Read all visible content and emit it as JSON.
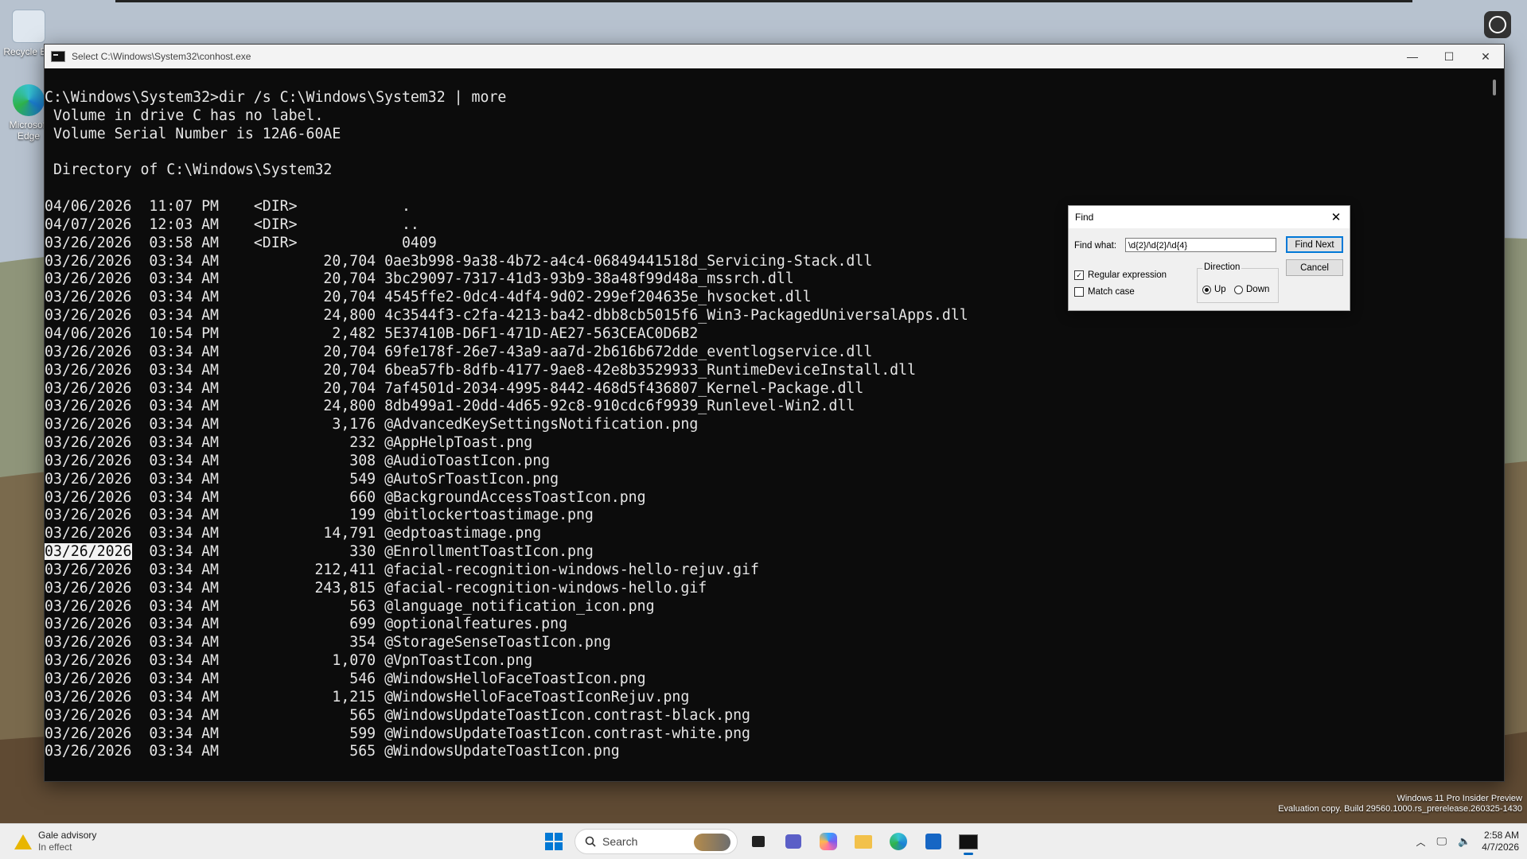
{
  "desktop": {
    "icons": [
      {
        "label": "Recycle Bin"
      },
      {
        "label": "Microsoft Edge"
      }
    ],
    "watermark": {
      "line1": "Windows 11 Pro Insider Preview",
      "line2": "Evaluation copy. Build 29560.1000.rs_prerelease.260325-1430"
    }
  },
  "window": {
    "title": "Select C:\\Windows\\System32\\conhost.exe",
    "controls": {
      "minimize": "—",
      "maximize": "☐",
      "close": "✕"
    }
  },
  "console": {
    "header_lines": [
      "C:\\Windows\\System32>dir /s C:\\Windows\\System32 | more",
      " Volume in drive C has no label.",
      " Volume Serial Number is 12A6-60AE",
      "",
      " Directory of C:\\Windows\\System32",
      ""
    ],
    "selected_row_index": 19,
    "entries": [
      {
        "date": "04/06/2026",
        "time": "11:07 PM",
        "size": "<DIR>",
        "name": "."
      },
      {
        "date": "04/07/2026",
        "time": "12:03 AM",
        "size": "<DIR>",
        "name": ".."
      },
      {
        "date": "03/26/2026",
        "time": "03:58 AM",
        "size": "<DIR>",
        "name": "0409"
      },
      {
        "date": "03/26/2026",
        "time": "03:34 AM",
        "size": "20,704",
        "name": "0ae3b998-9a38-4b72-a4c4-06849441518d_Servicing-Stack.dll"
      },
      {
        "date": "03/26/2026",
        "time": "03:34 AM",
        "size": "20,704",
        "name": "3bc29097-7317-41d3-93b9-38a48f99d48a_mssrch.dll"
      },
      {
        "date": "03/26/2026",
        "time": "03:34 AM",
        "size": "20,704",
        "name": "4545ffe2-0dc4-4df4-9d02-299ef204635e_hvsocket.dll"
      },
      {
        "date": "03/26/2026",
        "time": "03:34 AM",
        "size": "24,800",
        "name": "4c3544f3-c2fa-4213-ba42-dbb8cb5015f6_Win3-PackagedUniversalApps.dll"
      },
      {
        "date": "04/06/2026",
        "time": "10:54 PM",
        "size": "2,482",
        "name": "5E37410B-D6F1-471D-AE27-563CEAC0D6B2"
      },
      {
        "date": "03/26/2026",
        "time": "03:34 AM",
        "size": "20,704",
        "name": "69fe178f-26e7-43a9-aa7d-2b616b672dde_eventlogservice.dll"
      },
      {
        "date": "03/26/2026",
        "time": "03:34 AM",
        "size": "20,704",
        "name": "6bea57fb-8dfb-4177-9ae8-42e8b3529933_RuntimeDeviceInstall.dll"
      },
      {
        "date": "03/26/2026",
        "time": "03:34 AM",
        "size": "20,704",
        "name": "7af4501d-2034-4995-8442-468d5f436807_Kernel-Package.dll"
      },
      {
        "date": "03/26/2026",
        "time": "03:34 AM",
        "size": "24,800",
        "name": "8db499a1-20dd-4d65-92c8-910cdc6f9939_Runlevel-Win2.dll"
      },
      {
        "date": "03/26/2026",
        "time": "03:34 AM",
        "size": "3,176",
        "name": "@AdvancedKeySettingsNotification.png"
      },
      {
        "date": "03/26/2026",
        "time": "03:34 AM",
        "size": "232",
        "name": "@AppHelpToast.png"
      },
      {
        "date": "03/26/2026",
        "time": "03:34 AM",
        "size": "308",
        "name": "@AudioToastIcon.png"
      },
      {
        "date": "03/26/2026",
        "time": "03:34 AM",
        "size": "549",
        "name": "@AutoSrToastIcon.png"
      },
      {
        "date": "03/26/2026",
        "time": "03:34 AM",
        "size": "660",
        "name": "@BackgroundAccessToastIcon.png"
      },
      {
        "date": "03/26/2026",
        "time": "03:34 AM",
        "size": "199",
        "name": "@bitlockertoastimage.png"
      },
      {
        "date": "03/26/2026",
        "time": "03:34 AM",
        "size": "14,791",
        "name": "@edptoastimage.png"
      },
      {
        "date": "03/26/2026",
        "time": "03:34 AM",
        "size": "330",
        "name": "@EnrollmentToastIcon.png"
      },
      {
        "date": "03/26/2026",
        "time": "03:34 AM",
        "size": "212,411",
        "name": "@facial-recognition-windows-hello-rejuv.gif"
      },
      {
        "date": "03/26/2026",
        "time": "03:34 AM",
        "size": "243,815",
        "name": "@facial-recognition-windows-hello.gif"
      },
      {
        "date": "03/26/2026",
        "time": "03:34 AM",
        "size": "563",
        "name": "@language_notification_icon.png"
      },
      {
        "date": "03/26/2026",
        "time": "03:34 AM",
        "size": "699",
        "name": "@optionalfeatures.png"
      },
      {
        "date": "03/26/2026",
        "time": "03:34 AM",
        "size": "354",
        "name": "@StorageSenseToastIcon.png"
      },
      {
        "date": "03/26/2026",
        "time": "03:34 AM",
        "size": "1,070",
        "name": "@VpnToastIcon.png"
      },
      {
        "date": "03/26/2026",
        "time": "03:34 AM",
        "size": "546",
        "name": "@WindowsHelloFaceToastIcon.png"
      },
      {
        "date": "03/26/2026",
        "time": "03:34 AM",
        "size": "1,215",
        "name": "@WindowsHelloFaceToastIconRejuv.png"
      },
      {
        "date": "03/26/2026",
        "time": "03:34 AM",
        "size": "565",
        "name": "@WindowsUpdateToastIcon.contrast-black.png"
      },
      {
        "date": "03/26/2026",
        "time": "03:34 AM",
        "size": "599",
        "name": "@WindowsUpdateToastIcon.contrast-white.png"
      },
      {
        "date": "03/26/2026",
        "time": "03:34 AM",
        "size": "565",
        "name": "@WindowsUpdateToastIcon.png"
      }
    ]
  },
  "find_dialog": {
    "title": "Find",
    "find_what_label": "Find what:",
    "find_what_value": "\\d{2}/\\d{2}/\\d{4}",
    "find_next_label": "Find Next",
    "cancel_label": "Cancel",
    "regex_label": "Regular expression",
    "regex_checked": true,
    "match_case_label": "Match case",
    "match_case_checked": false,
    "direction_label": "Direction",
    "up_label": "Up",
    "down_label": "Down",
    "direction_selected": "up"
  },
  "taskbar": {
    "weather_title": "Gale advisory",
    "weather_sub": "In effect",
    "search_label": "Search",
    "time": "2:58 AM",
    "date": "4/7/2026"
  }
}
